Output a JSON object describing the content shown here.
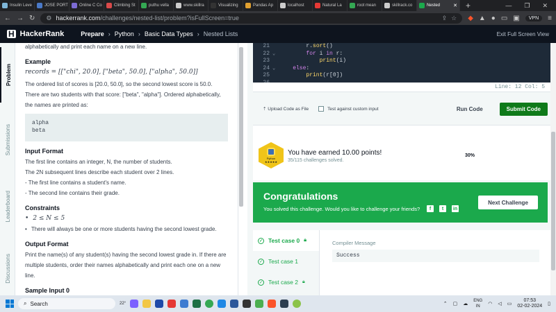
{
  "browser": {
    "tabs": [
      {
        "label": "Insulin Leve",
        "color": "#7fb6d8"
      },
      {
        "label": "JOSE PORT",
        "color": "#4a79c7"
      },
      {
        "label": "Online C Co",
        "color": "#7c6bd3"
      },
      {
        "label": "Climbing St",
        "color": "#d94a4a"
      },
      {
        "label": "puthu vella",
        "color": "#34a853"
      },
      {
        "label": "www.skillra",
        "color": "#cccccc"
      },
      {
        "label": "Visualizing",
        "color": "#333333"
      },
      {
        "label": "Pandas Ap",
        "color": "#e0a030"
      },
      {
        "label": "localhost",
        "color": "#cccccc"
      },
      {
        "label": "Natural La",
        "color": "#e53935"
      },
      {
        "label": "root mean",
        "color": "#34a853"
      },
      {
        "label": "skillrack.co",
        "color": "#cccccc"
      },
      {
        "label": "Nested",
        "color": "#1ba94c"
      }
    ],
    "url_domain": "hackerrank.com",
    "url_path": "/challenges/nested-list/problem?isFullScreen=true",
    "vpn_label": "VPN"
  },
  "header": {
    "logo": "H",
    "brand": "HackerRank",
    "crumbs": [
      "Prepare",
      "Python",
      "Basic Data Types",
      "Nested Lists"
    ],
    "exit_label": "Exit Full Screen View"
  },
  "vtabs": [
    "Problem",
    "Submissions",
    "Leaderboard",
    "Discussions"
  ],
  "problem": {
    "intro": "alphabetically and print each name on a new line.",
    "example_heading": "Example",
    "records_line": "records = [[\"chi\", 20.0], [\"beta\", 50.0], [\"alpha\", 50.0]]",
    "explanation": "The ordered list of scores is [20.0, 50.0], so the second lowest score is 50.0. There are two students with that score: [\"beta\", \"alpha\"]. Ordered alphabetically, the names are printed as:",
    "example_output": [
      "alpha",
      "beta"
    ],
    "input_format_heading": "Input Format",
    "input_format_lines": [
      "The first line contains an integer, N, the number of students.",
      "The 2N subsequent lines describe each student over 2 lines.",
      "- The first line contains a student's name.",
      "- The second line contains their grade."
    ],
    "constraints_heading": "Constraints",
    "constraints": [
      "2 ≤ N ≤ 5",
      "There will always be one or more students having the second lowest grade."
    ],
    "output_format_heading": "Output Format",
    "output_format_text": "Print the name(s) of any student(s) having the second lowest grade in. If there are multiple students, order their names alphabetically and print each one on a new line.",
    "sample_input_heading": "Sample Input 0"
  },
  "editor": {
    "lines": [
      {
        "n": "21",
        "fold": "",
        "code": "        r.sort()"
      },
      {
        "n": "22",
        "fold": "v",
        "code": "        for i in r:"
      },
      {
        "n": "23",
        "fold": "",
        "code": "            print(i)"
      },
      {
        "n": "24",
        "fold": "v",
        "code": "    else:"
      },
      {
        "n": "25",
        "fold": "",
        "code": "        print(r[0])"
      },
      {
        "n": "26",
        "fold": "",
        "code": ""
      }
    ],
    "status": "Line: 12 Col: 5"
  },
  "actions": {
    "upload_label": "Upload Code as File",
    "custom_input_label": "Test against custom input",
    "run_label": "Run Code",
    "submit_label": "Submit Code"
  },
  "points": {
    "badge_label": "Python",
    "badge_stars": "★★★★★",
    "title": "You have earned 10.00 points!",
    "subtitle": "35/115 challenges solved.",
    "percent": "30%"
  },
  "congrats": {
    "title": "Congratulations",
    "subtitle": "You solved this challenge. Would you like to challenge your friends?",
    "next_label": "Next Challenge",
    "social": [
      "f",
      "t",
      "in"
    ]
  },
  "results": {
    "testcases": [
      "Test case 0",
      "Test case 1",
      "Test case 2"
    ],
    "compiler_label": "Compiler Message",
    "compiler_value": "Success"
  },
  "taskbar": {
    "search_placeholder": "Search",
    "weather": "22°",
    "lang_top": "ENG",
    "lang_bottom": "IN",
    "time": "07:53",
    "date": "02-02-2024"
  }
}
